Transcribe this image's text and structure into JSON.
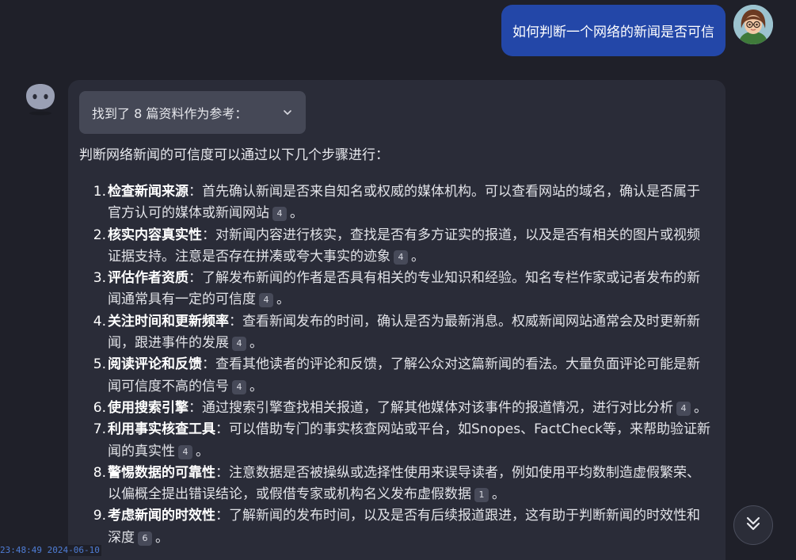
{
  "user_message": {
    "text": "如何判断一个网络的新闻是否可信"
  },
  "references": {
    "label": "找到了 8 篇资料作为参考："
  },
  "answer": {
    "intro": "判断网络新闻的可信度可以通过以下几个步骤进行：",
    "steps": [
      {
        "num": "1.",
        "title": "检查新闻来源",
        "body": "：首先确认新闻是否来自知名或权威的媒体机构。可以查看网站的域名，确认是否属于官方认可的媒体或新闻网站",
        "cite": "4",
        "end": "。"
      },
      {
        "num": "2.",
        "title": "核实内容真实性",
        "body": "：对新闻内容进行核实，查找是否有多方证实的报道，以及是否有相关的图片或视频证据支持。注意是否存在拼凑或夸大事实的迹象",
        "cite": "4",
        "end": "。"
      },
      {
        "num": "3.",
        "title": "评估作者资质",
        "body": "：了解发布新闻的作者是否具有相关的专业知识和经验。知名专栏作家或记者发布的新闻通常具有一定的可信度",
        "cite": "4",
        "end": "。"
      },
      {
        "num": "4.",
        "title": "关注时间和更新频率",
        "body": "：查看新闻发布的时间，确认是否为最新消息。权威新闻网站通常会及时更新新闻，跟进事件的发展",
        "cite": "4",
        "end": "。"
      },
      {
        "num": "5.",
        "title": "阅读评论和反馈",
        "body": "：查看其他读者的评论和反馈，了解公众对这篇新闻的看法。大量负面评论可能是新闻可信度不高的信号",
        "cite": "4",
        "end": "。"
      },
      {
        "num": "6.",
        "title": "使用搜索引擎",
        "body": "：通过搜索引擎查找相关报道，了解其他媒体对该事件的报道情况，进行对比分析",
        "cite": "4",
        "end": "。"
      },
      {
        "num": "7.",
        "title": "利用事实核查工具",
        "body": "：可以借助专门的事实核查网站或平台，如Snopes、FactCheck等，来帮助验证新闻的真实性",
        "cite": "4",
        "end": "。"
      },
      {
        "num": "8.",
        "title": "警惕数据的可靠性",
        "body": "：注意数据是否被操纵或选择性使用来误导读者，例如使用平均数制造虚假繁荣、以偏概全提出错误结论，或假借专家或机构名义发布虚假数据",
        "cite": "1",
        "end": "。"
      },
      {
        "num": "9.",
        "title": "考虑新闻的时效性",
        "body": "：了解新闻的发布时间，以及是否有后续报道跟进，这有助于判断新闻的时效性和深度",
        "cite": "6",
        "end": "。"
      }
    ]
  },
  "timestamp": "23:48:49 2024-06-10",
  "icons": {
    "user_avatar": "user-avatar-icon",
    "bot_avatar": "bot-avatar-icon",
    "chevron": "chevron-down-icon",
    "scroll": "double-chevron-down-icon"
  },
  "colors": {
    "background": "#1f2029",
    "user_bubble": "#2347a8",
    "card": "#2a2c38",
    "timestamp": "#4f7dd6"
  }
}
